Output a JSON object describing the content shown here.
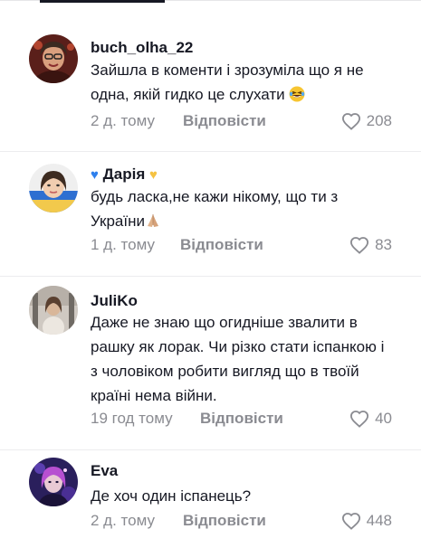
{
  "comments": [
    {
      "author": "buch_olha_22",
      "text": "Зайшла в коменти і зрозуміла що я не одна, якій гидко це слухати",
      "emoji": "laughing-emoji",
      "time": "2 д. тому",
      "reply_label": "Відповісти",
      "likes": "208"
    },
    {
      "author": "Дарія",
      "text": "будь ласка,не кажи нікому, що ти з України",
      "emoji": "praying-hands-emoji",
      "time": "1 д. тому",
      "reply_label": "Відповісти",
      "likes": "83"
    },
    {
      "author": "JuliKo",
      "text": "Даже не знаю що огидніше звалити в рашку як лорак. Чи різко стати іспанкою і з чоловіком робити вигляд що в твоїй країні нема війни.",
      "time": "19 год тому",
      "reply_label": "Відповісти",
      "likes": "40"
    },
    {
      "author": "Eva",
      "text": "Де хоч один іспанець?",
      "time": "2 д. тому",
      "reply_label": "Відповісти",
      "likes": "448"
    }
  ],
  "icons": {
    "like": "heart-outline-icon",
    "author_decoration_left": "blue-heart-icon",
    "author_decoration_right": "yellow-heart-icon"
  },
  "colors": {
    "text": "#161823",
    "secondary": "#8a8b91",
    "divider": "#ececee"
  }
}
